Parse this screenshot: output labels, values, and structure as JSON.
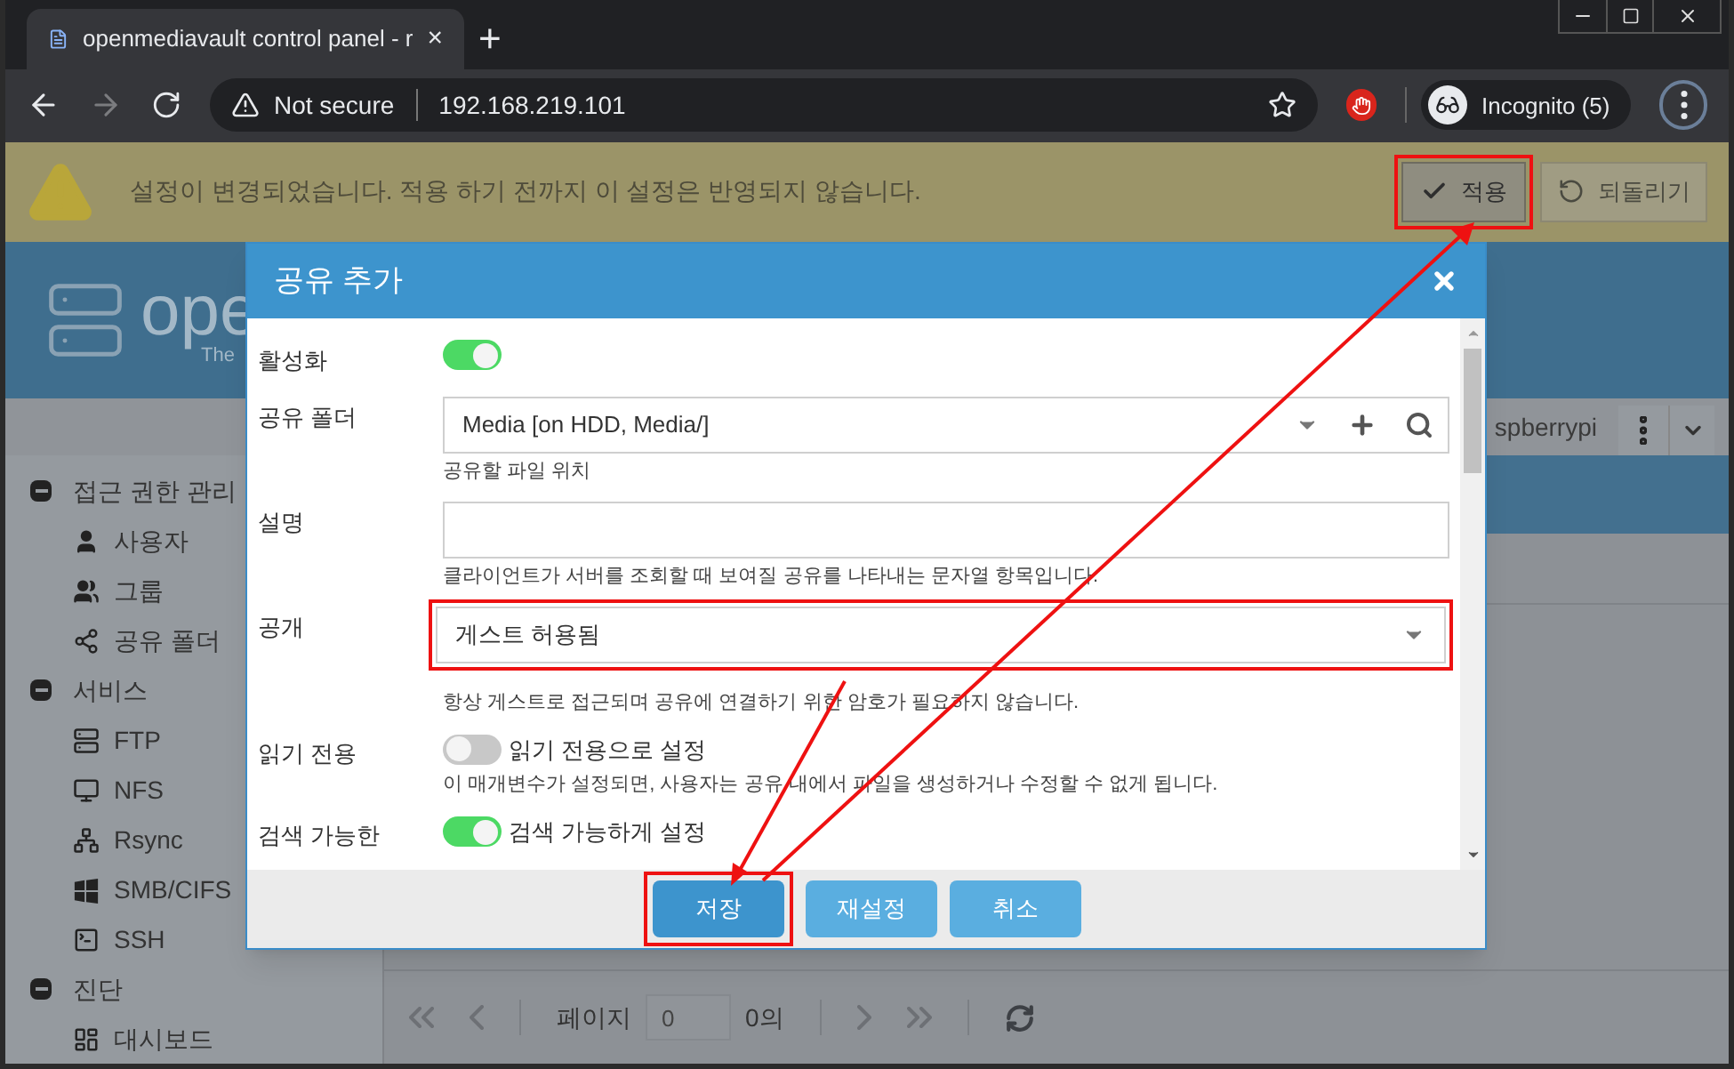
{
  "browser": {
    "tab_title": "openmediavault control panel - r",
    "tab_close": "×",
    "new_tab": "+",
    "security": "Not secure",
    "url": "192.168.219.101",
    "profile": "Incognito (5)"
  },
  "notification": {
    "message": "설정이 변경되었습니다. 적용 하기 전까지 이 설정은 반영되지 않습니다.",
    "buttons": [
      {
        "label": "적용",
        "kind": "apply"
      },
      {
        "label": "되돌리기",
        "kind": "revert"
      }
    ]
  },
  "header": {
    "logo_text": "ope",
    "logo_subtext": "The"
  },
  "toolbar": {
    "host": "spberrypi"
  },
  "sidebar": {
    "groups": [
      {
        "label": "접근 권한 관리",
        "expanded": true,
        "children": [
          {
            "label": "사용자"
          },
          {
            "label": "그룹"
          },
          {
            "label": "공유 폴더"
          }
        ]
      },
      {
        "label": "서비스",
        "expanded": true,
        "children": [
          {
            "label": "FTP"
          },
          {
            "label": "NFS"
          },
          {
            "label": "Rsync"
          },
          {
            "label": "SMB/CIFS"
          },
          {
            "label": "SSH"
          }
        ]
      },
      {
        "label": "진단",
        "expanded": true,
        "children": [
          {
            "label": "대시보드"
          }
        ]
      }
    ]
  },
  "pager": {
    "page_label": "페이지",
    "page_value": "0",
    "page_total": "0의"
  },
  "dialog": {
    "title": "공유 추가",
    "fields": [
      {
        "kind": "toggle",
        "label": "활성화",
        "on": true
      },
      {
        "kind": "combo",
        "label": "공유 폴더",
        "value": "Media [on HDD, Media/]",
        "help": "공유할 파일 위치"
      },
      {
        "kind": "text",
        "label": "설명",
        "help": "클라이언트가 서버를 조회할 때 보여질 공유를 나타내는 문자열 항목입니다."
      },
      {
        "kind": "select",
        "label": "공개",
        "value": "게스트 허용됨",
        "help": "항상 게스트로 접근되며 공유에 연결하기 위한 암호가 필요하지 않습니다."
      },
      {
        "kind": "toggle",
        "label": "읽기 전용",
        "on": false,
        "text": "읽기 전용으로 설정",
        "help": "이 매개변수가 설정되면, 사용자는 공유 내에서 파일을 생성하거나 수정할 수 없게 됩니다."
      },
      {
        "kind": "toggle",
        "label": "검색 가능한",
        "on": true,
        "text": "검색 가능하게 설정"
      }
    ],
    "buttons": [
      {
        "label": "저장",
        "kind": "primary"
      },
      {
        "label": "재설정",
        "kind": "secondary"
      },
      {
        "label": "취소",
        "kind": "secondary"
      }
    ]
  }
}
